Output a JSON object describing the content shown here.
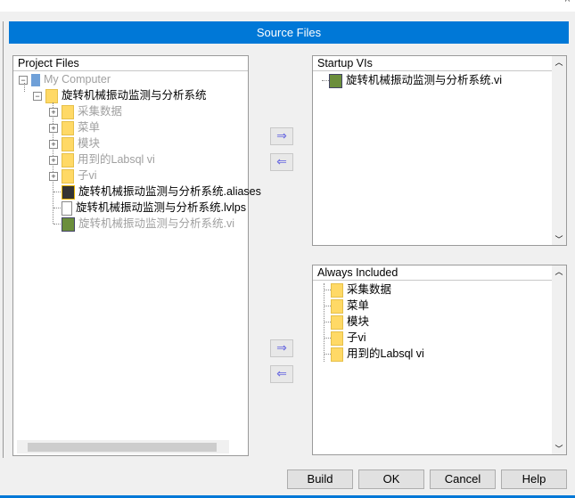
{
  "banner": {
    "title": "Source Files"
  },
  "project_files": {
    "header": "Project Files",
    "root": "My Computer",
    "project": "旋转机械振动监测与分析系统",
    "items": [
      {
        "label": "采集数据",
        "type": "folder",
        "dimmed": true
      },
      {
        "label": "菜单",
        "type": "folder",
        "dimmed": true
      },
      {
        "label": "模块",
        "type": "folder",
        "dimmed": true
      },
      {
        "label": "用到的Labsql  vi",
        "type": "folder",
        "dimmed": true
      },
      {
        "label": "子vi",
        "type": "folder",
        "dimmed": true
      },
      {
        "label": "旋转机械振动监测与分析系统.aliases",
        "type": "aliases",
        "dimmed": false
      },
      {
        "label": "旋转机械振动监测与分析系统.lvlps",
        "type": "file",
        "dimmed": false
      },
      {
        "label": "旋转机械振动监测与分析系统.vi",
        "type": "vi",
        "dimmed": true
      }
    ]
  },
  "startup_vis": {
    "header": "Startup VIs",
    "items": [
      "旋转机械振动监测与分析系统.vi"
    ]
  },
  "always_included": {
    "header": "Always Included",
    "items": [
      "采集数据",
      "菜单",
      "模块",
      "子vi",
      "用到的Labsql  vi"
    ]
  },
  "buttons": {
    "build": "Build",
    "ok": "OK",
    "cancel": "Cancel",
    "help": "Help"
  },
  "arrows": {
    "right": "⇒",
    "left": "⇐"
  }
}
